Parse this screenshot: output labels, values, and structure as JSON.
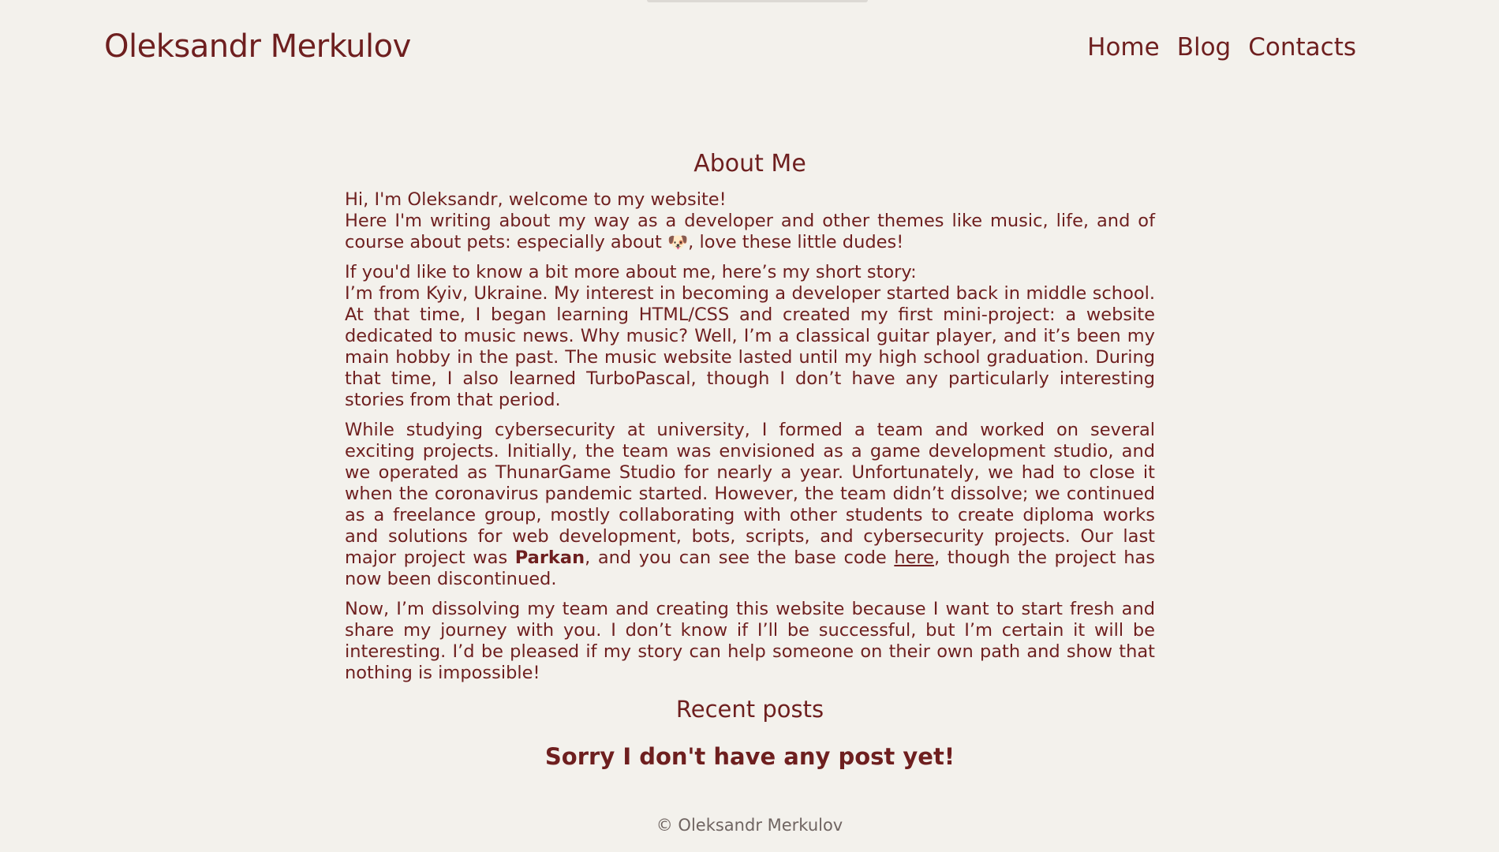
{
  "header": {
    "site_title": "Oleksandr Merkulov",
    "nav": [
      "Home",
      "Blog",
      "Contacts"
    ]
  },
  "about": {
    "title": "About Me",
    "p1_line1": "Hi, I'm Oleksandr, welcome to my website!",
    "p1_line2_a": "Here I'm writing about my way as a developer and other themes like music, life, and of course about pets: especially about ",
    "p1_line2_icon": "dog-face-icon",
    "p1_line2_emoji": "🐶",
    "p1_line2_b": ", love these little dudes!",
    "p2_line1": "If you'd like to know a bit more about me, here’s my short story:",
    "p2_body": "I’m from Kyiv, Ukraine. My interest in becoming a developer started back in middle school. At that time, I began learning HTML/CSS and created my first mini-project: a website dedicated to music news. Why music? Well, I’m a classical guitar player, and it’s been my main hobby in the past. The music website lasted until my high school graduation. During that time, I also learned TurboPascal, though I don’t have any particularly interesting stories from that period.",
    "p3_a": "While studying cybersecurity at university, I formed a team and worked on several exciting projects. Initially, the team was envisioned as a game development studio, and we operated as ThunarGame Studio for nearly a year. Unfortunately, we had to close it when the coronavirus pandemic started. However, the team didn’t dissolve; we continued as a freelance group, mostly collaborating with other students to create diploma works and solutions for web development, bots, scripts, and cybersecurity projects. Our last major project was ",
    "p3_bold": "Parkan",
    "p3_b": ", and you can see the base code ",
    "p3_link": "here",
    "p3_c": ", though the project has now been discontinued.",
    "p4": "Now, I’m dissolving my team and creating this website because I want to start fresh and share my journey with you. I don’t know if I’ll be successful, but I’m certain it will be interesting. I’d be pleased if my story can help someone on their own path and show that nothing is impossible!"
  },
  "recent": {
    "title": "Recent posts",
    "empty_message": "Sorry I don't have any post yet!"
  },
  "footer": {
    "copyright": "© Oleksandr Merkulov"
  },
  "colors": {
    "background": "#f3f1ec",
    "text": "#6e1f1f",
    "footer_text": "#6f6461"
  }
}
